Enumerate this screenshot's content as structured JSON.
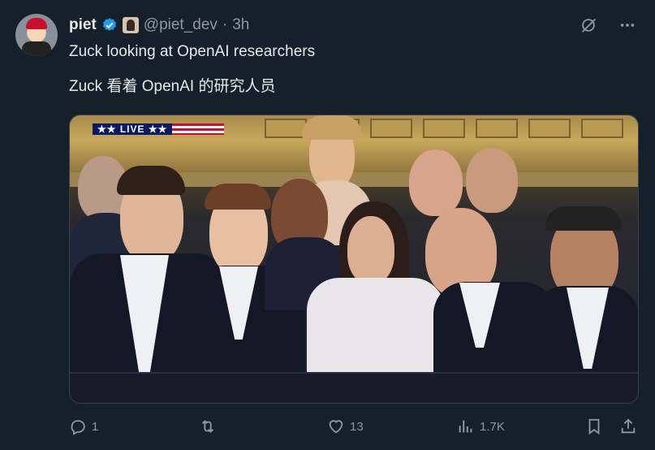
{
  "post": {
    "author_name": "piet",
    "handle": "@piet_dev",
    "separator": "·",
    "time": "3h",
    "text_line1": "Zuck looking at OpenAI researchers",
    "text_line2": "Zuck 看着 OpenAI 的研究人员"
  },
  "media": {
    "live_label": "★★ LIVE ★★"
  },
  "actions": {
    "reply_count": "1",
    "repost_count": "",
    "like_count": "13",
    "views_count": "1.7K"
  },
  "icons": {
    "verified": "verified-badge-icon",
    "grok": "grok-icon",
    "more": "more-icon",
    "reply": "reply-icon",
    "repost": "repost-icon",
    "like": "like-icon",
    "views": "views-icon",
    "bookmark": "bookmark-icon",
    "share": "share-icon"
  },
  "colors": {
    "background": "#15202b",
    "text": "#e7e9ea",
    "muted": "#8b98a5",
    "verified": "#1d9bf0"
  }
}
